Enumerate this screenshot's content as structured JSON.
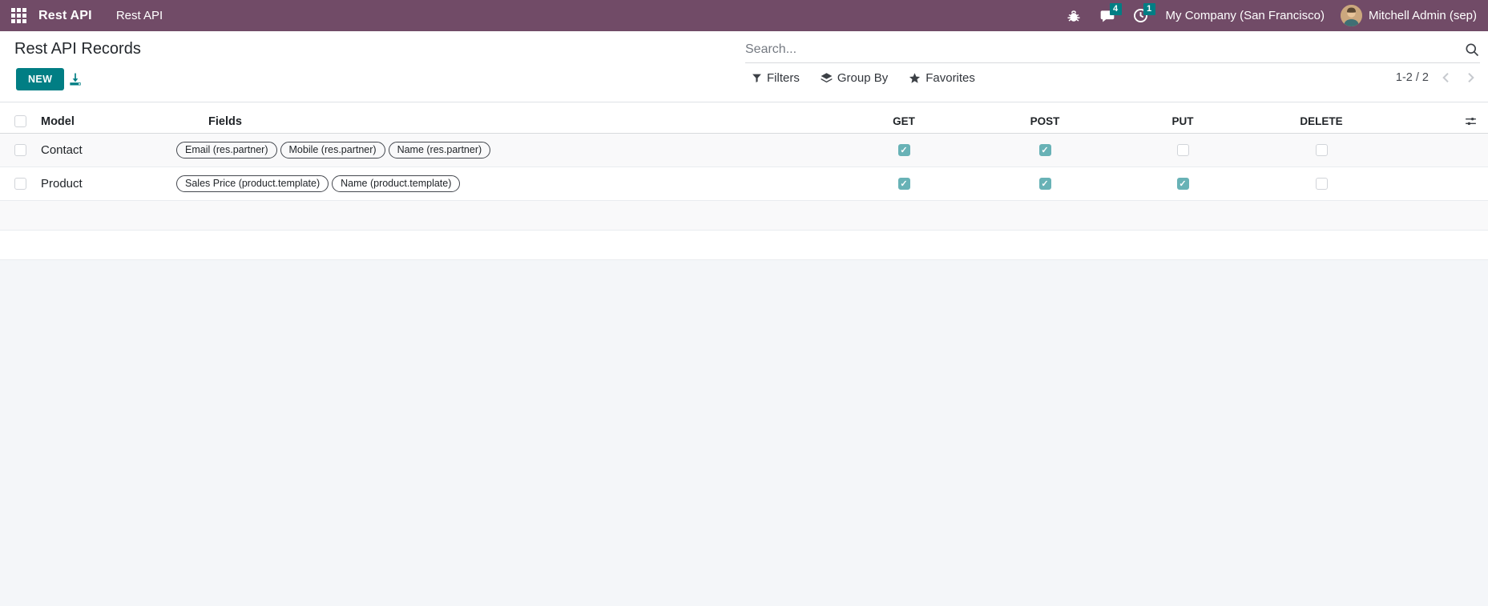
{
  "topbar": {
    "brand": "Rest API",
    "menu_item": "Rest API",
    "messages_badge": "4",
    "activities_badge": "1",
    "company": "My Company (San Francisco)",
    "user": "Mitchell Admin (sep)"
  },
  "control_panel": {
    "title": "Rest API Records",
    "new_button": "NEW",
    "search": {
      "placeholder": "Search..."
    },
    "filters_label": "Filters",
    "group_by_label": "Group By",
    "favorites_label": "Favorites",
    "pager_text": "1-2 / 2"
  },
  "table": {
    "columns": {
      "model": "Model",
      "fields": "Fields",
      "get": "GET",
      "post": "POST",
      "put": "PUT",
      "delete": "DELETE"
    },
    "rows": [
      {
        "model": "Contact",
        "tags": [
          "Email (res.partner)",
          "Mobile (res.partner)",
          "Name (res.partner)"
        ],
        "get": true,
        "post": true,
        "put": false,
        "delete": false
      },
      {
        "model": "Product",
        "tags": [
          "Sales Price (product.template)",
          "Name (product.template)"
        ],
        "get": true,
        "post": true,
        "put": true,
        "delete": false
      }
    ]
  },
  "colors": {
    "topbar_bg": "#714b67",
    "accent_teal": "#017e84",
    "checked_checkbox": "#68b2b6",
    "page_bg": "#f4f6f9"
  }
}
